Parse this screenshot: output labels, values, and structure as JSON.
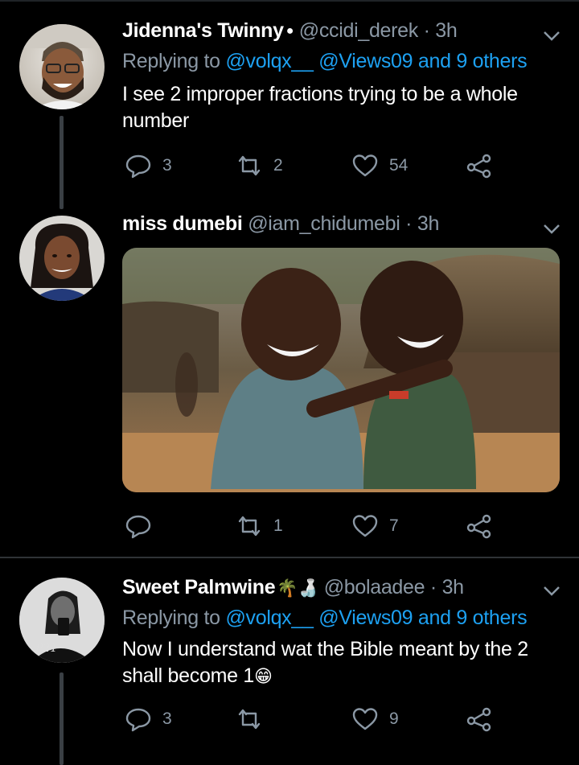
{
  "tweets": [
    {
      "name": "Jidenna's Twinny",
      "name_badge": "●",
      "handle": "@ccidi_derek",
      "time": "· 3h",
      "reply_prefix": "Replying to",
      "reply_mentions": "@volqx__ @Views09",
      "reply_and": "and",
      "reply_others": "9 others",
      "text": "I see 2 improper fractions trying to be a whole number",
      "reply_count": "3",
      "retweet_count": "2",
      "like_count": "54"
    },
    {
      "name": "miss dumebi",
      "handle": "@iam_chidumebi",
      "time": "· 3h",
      "reply_count": "",
      "retweet_count": "1",
      "like_count": "7"
    },
    {
      "name": "Sweet Palmwine",
      "name_emoji": "🌴🍶",
      "handle": "@bolaadee",
      "time": "· 3h",
      "reply_prefix": "Replying to",
      "reply_mentions": "@volqx__ @Views09",
      "reply_and": "and",
      "reply_others": "9 others",
      "text": "Now I understand wat the Bible meant by the 2 shall become 1",
      "text_emoji": "😁",
      "reply_count": "3",
      "retweet_count": "",
      "like_count": "9"
    }
  ],
  "colors": {
    "background": "#000000",
    "secondary_text": "#8b98a5",
    "link": "#1da1f2",
    "separator": "#2f3336"
  },
  "icons": {
    "reply": "reply-icon",
    "retweet": "retweet-icon",
    "like": "heart-icon",
    "share": "share-icon",
    "more": "chevron-down-icon"
  }
}
